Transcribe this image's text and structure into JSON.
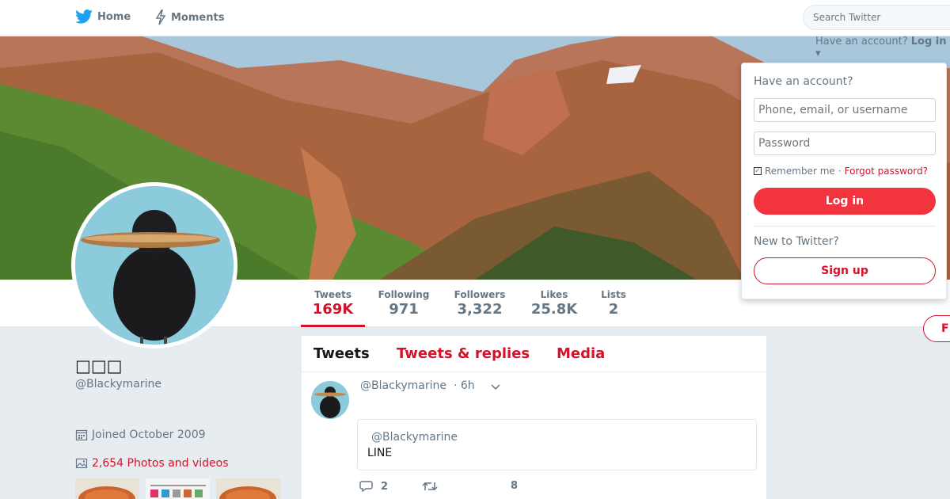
{
  "nav": {
    "home_label": "Home",
    "moments_label": "Moments",
    "search_placeholder": "Search Twitter"
  },
  "login_toggle": {
    "prompt": "Have an account?",
    "link": "Log in"
  },
  "login_dropdown": {
    "heading": "Have an account?",
    "username_placeholder": "Phone, email, or username",
    "password_placeholder": "Password",
    "remember_label": "Remember me",
    "separator": "·",
    "forgot_label": "Forgot password?",
    "login_button": "Log in",
    "new_heading": "New to Twitter?",
    "signup_button": "Sign up"
  },
  "stats": [
    {
      "label": "Tweets",
      "value": "169K"
    },
    {
      "label": "Following",
      "value": "971"
    },
    {
      "label": "Followers",
      "value": "3,322"
    },
    {
      "label": "Likes",
      "value": "25.8K"
    },
    {
      "label": "Lists",
      "value": "2"
    }
  ],
  "follow_button": "F",
  "profile": {
    "name": "□□□",
    "handle": "@Blackymarine",
    "joined": "Joined October 2009",
    "photos": "2,654 Photos and videos"
  },
  "timeline": {
    "tabs": [
      "Tweets",
      "Tweets & replies",
      "Media"
    ],
    "tweet": {
      "handle": "@Blackymarine",
      "time": "· 6h",
      "quote_handle": "@Blackymarine",
      "quote_text": "LINE",
      "reply_count": "2",
      "like_count": "8"
    }
  },
  "colors": {
    "accent": "#d4122a",
    "login_button": "#f2343f",
    "background": "#e6ecf0"
  }
}
